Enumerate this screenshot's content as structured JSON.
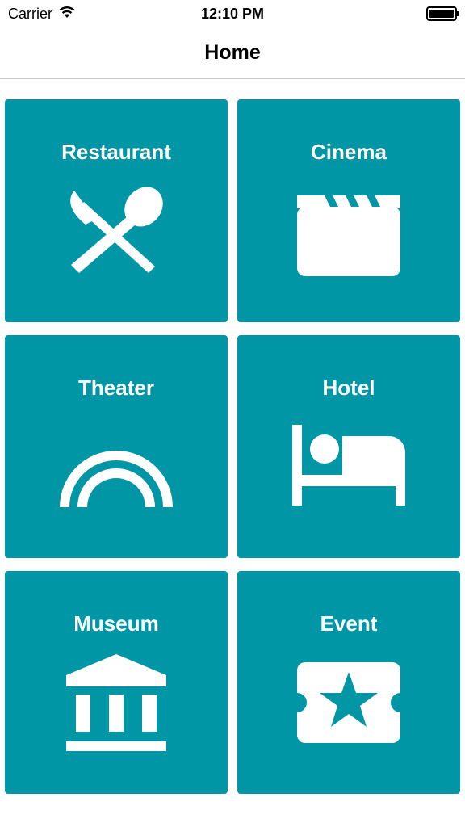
{
  "status_bar": {
    "carrier": "Carrier",
    "time": "12:10 PM",
    "signal_icon": "wifi-icon",
    "battery_icon": "battery-icon",
    "battery_level": 1.0
  },
  "nav": {
    "title": "Home"
  },
  "theme": {
    "tile_color": "#0096a5",
    "icon_color": "#ffffff"
  },
  "tiles": [
    {
      "label": "Restaurant",
      "icon": "fork-spoon-icon"
    },
    {
      "label": "Cinema",
      "icon": "clapperboard-icon"
    },
    {
      "label": "Theater",
      "icon": "arch-icon"
    },
    {
      "label": "Hotel",
      "icon": "bed-icon"
    },
    {
      "label": "Museum",
      "icon": "museum-icon"
    },
    {
      "label": "Event",
      "icon": "ticket-star-icon"
    }
  ]
}
